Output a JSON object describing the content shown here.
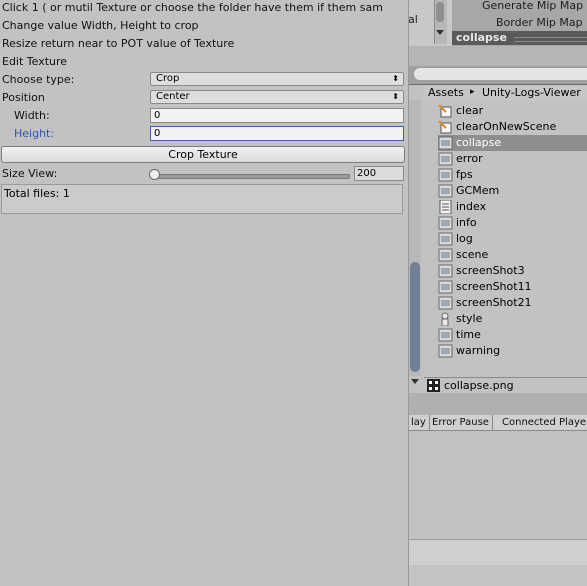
{
  "tool_window": {
    "info_lines": [
      "Click 1 ( or mutil Texture or choose the folder have them if them sam",
      "Change value Width, Height to crop",
      "Resize return near to POT value of Texture",
      "Edit Texture"
    ],
    "choose_type": {
      "label": "Choose type:",
      "value": "Crop"
    },
    "position": {
      "label": "Position",
      "value": "Center"
    },
    "width": {
      "label": "Width:",
      "value": "0"
    },
    "height": {
      "label": "Height:",
      "value": "0"
    },
    "crop_button_label": "Crop Texture",
    "size_view": {
      "label": "Size View:",
      "value": "200",
      "slider_fraction": 0.0
    },
    "total_files": "Total files: 1",
    "popup_arrow": "⬍"
  },
  "inspector": {
    "partial_label": "al",
    "generate_mip_maps": "Generate Mip Map",
    "border_mip_maps": "Border Mip Map",
    "selected_asset_title": "collapse"
  },
  "project": {
    "breadcrumb": {
      "root": "Assets",
      "sep": "▸",
      "folder": "Unity-Logs-Viewer"
    },
    "assets": [
      {
        "name": "clear",
        "icon": "script-icon",
        "selected": false
      },
      {
        "name": "clearOnNewScene",
        "icon": "script-icon",
        "selected": false
      },
      {
        "name": "collapse",
        "icon": "texture-icon",
        "selected": true
      },
      {
        "name": "error",
        "icon": "texture-icon",
        "selected": false
      },
      {
        "name": "fps",
        "icon": "texture-icon",
        "selected": false
      },
      {
        "name": "GCMem",
        "icon": "texture-icon",
        "selected": false
      },
      {
        "name": "index",
        "icon": "document-icon",
        "selected": false
      },
      {
        "name": "info",
        "icon": "texture-icon",
        "selected": false
      },
      {
        "name": "log",
        "icon": "texture-icon",
        "selected": false
      },
      {
        "name": "scene",
        "icon": "texture-icon",
        "selected": false
      },
      {
        "name": "screenShot3",
        "icon": "texture-icon",
        "selected": false
      },
      {
        "name": "screenShot11",
        "icon": "texture-icon",
        "selected": false
      },
      {
        "name": "screenShot21",
        "icon": "texture-icon",
        "selected": false
      },
      {
        "name": "style",
        "icon": "gui-skin-icon",
        "selected": false
      },
      {
        "name": "time",
        "icon": "texture-icon",
        "selected": false
      },
      {
        "name": "warning",
        "icon": "texture-icon",
        "selected": false
      }
    ],
    "selected_file": "collapse.png"
  },
  "console": {
    "tabs": [
      "lay",
      "Error Pause",
      "Connected Playe"
    ]
  },
  "colors": {
    "window_bg": "#c2c2c2",
    "selection": "#8e8e8e",
    "focus_label": "#2f55b4",
    "scroll_thumb": "#6f7f96"
  }
}
